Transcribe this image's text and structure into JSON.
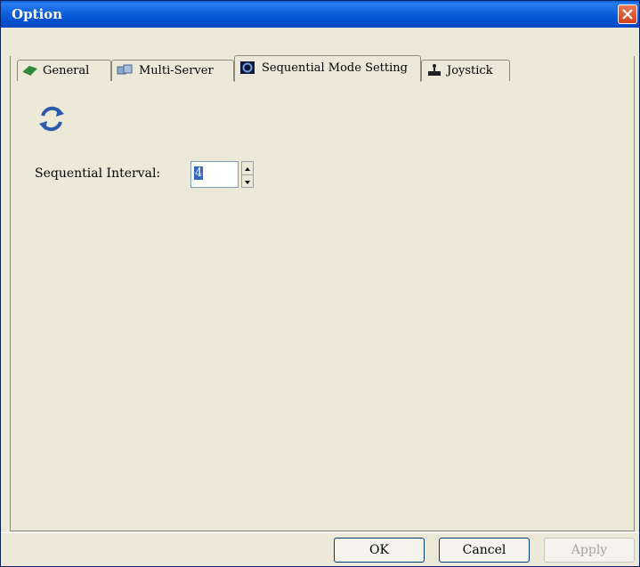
{
  "window": {
    "title": "Option"
  },
  "tabs": [
    {
      "label": "General",
      "icon": "book-icon"
    },
    {
      "label": "Multi-Server",
      "icon": "servers-icon"
    },
    {
      "label": "Sequential Mode Setting",
      "icon": "sequential-icon",
      "active": true
    },
    {
      "label": "Joystick",
      "icon": "joystick-icon"
    }
  ],
  "sequential": {
    "interval_label": "Sequential Interval:",
    "interval_value": "4"
  },
  "buttons": {
    "ok": "OK",
    "cancel": "Cancel",
    "apply": "Apply"
  },
  "colors": {
    "titlebar": "#0054e3",
    "face": "#ece9d8",
    "close": "#d0401a",
    "selection": "#316ac5"
  }
}
